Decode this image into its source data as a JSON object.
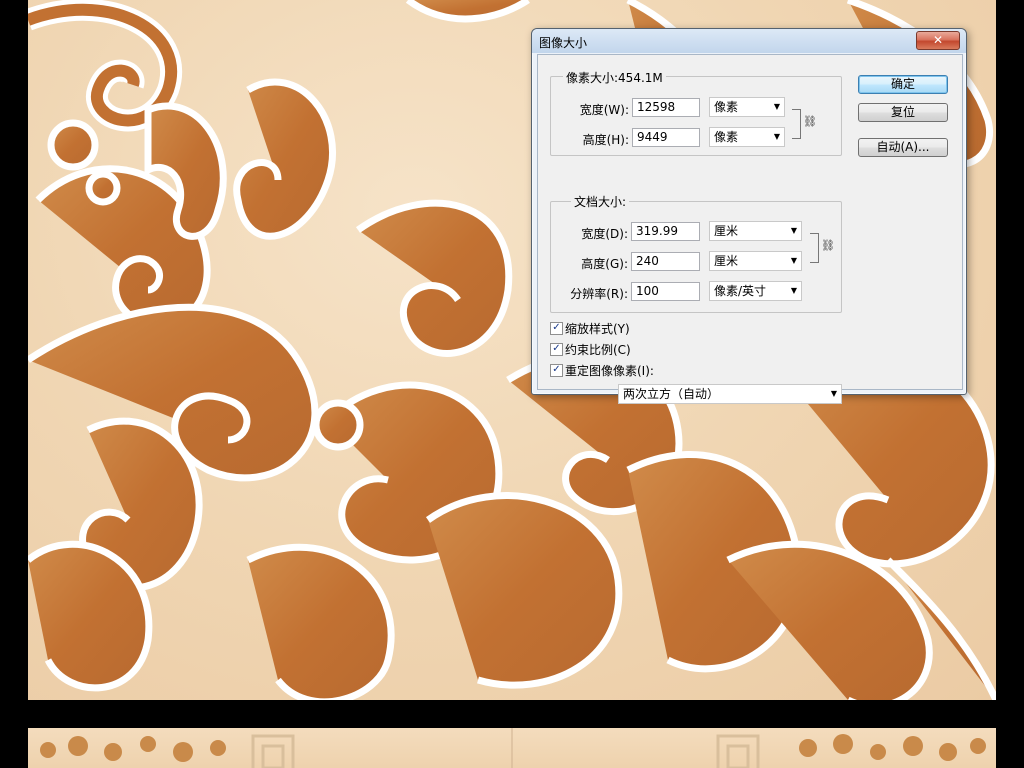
{
  "dialog": {
    "title": "图像大小",
    "close_label": "✕",
    "pixel_dimensions": {
      "legend": "像素大小:454.1M",
      "width_label": "宽度(W):",
      "width_value": "12598",
      "width_unit": "像素",
      "height_label": "高度(H):",
      "height_value": "9449",
      "height_unit": "像素"
    },
    "document_size": {
      "legend": "文档大小:",
      "width_label": "宽度(D):",
      "width_value": "319.99",
      "width_unit": "厘米",
      "height_label": "高度(G):",
      "height_value": "240",
      "height_unit": "厘米",
      "resolution_label": "分辨率(R):",
      "resolution_value": "100",
      "resolution_unit": "像素/英寸"
    },
    "options": {
      "scale_styles": {
        "label": "缩放样式(Y)",
        "checked": true
      },
      "constrain_proportions": {
        "label": "约束比例(C)",
        "checked": true
      },
      "resample_image": {
        "label": "重定图像像素(I):",
        "checked": true
      },
      "resample_method": "两次立方（自动）"
    },
    "buttons": {
      "ok": "确定",
      "reset": "复位",
      "auto": "自动(A)..."
    }
  },
  "colors": {
    "ornament_brown": "#c97d3e",
    "ornament_outline": "#ffffff",
    "background_cream": "#f3dcbd",
    "page_background": "#000000"
  }
}
